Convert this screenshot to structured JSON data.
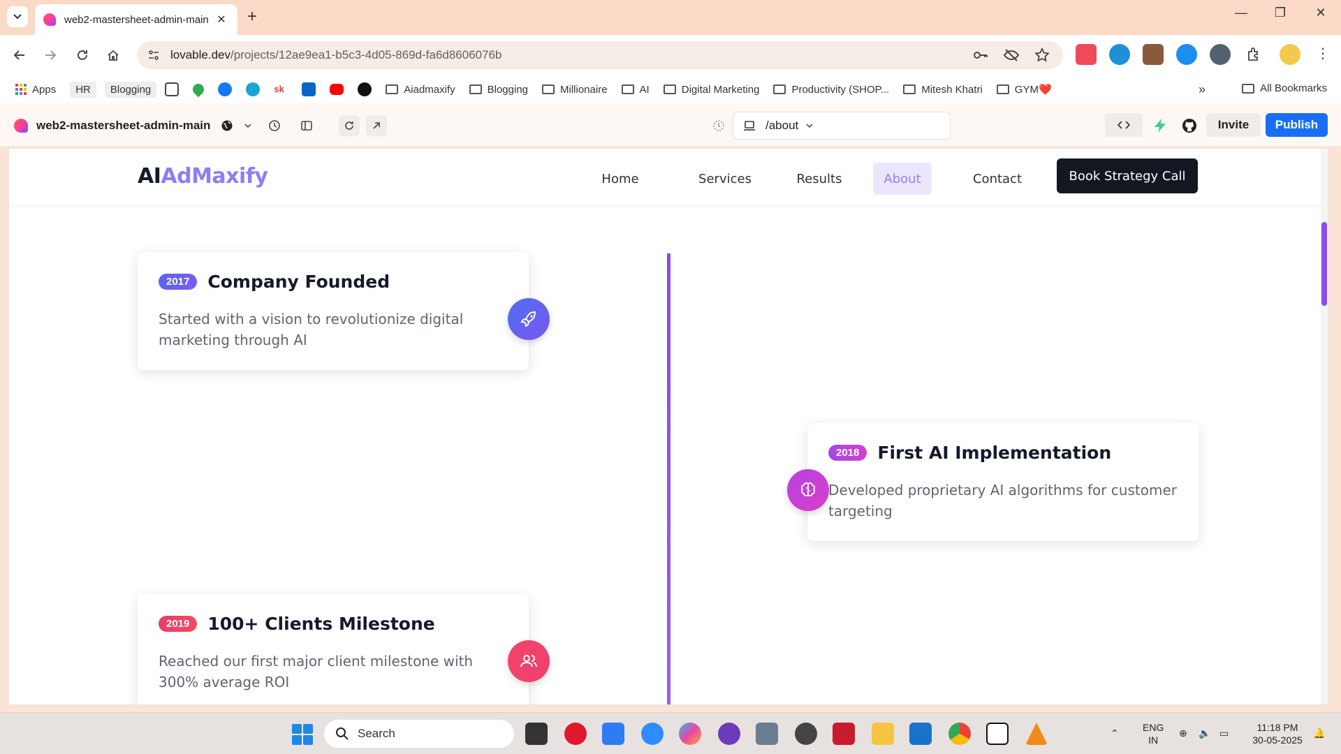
{
  "browser": {
    "tab_title": "web2-mastersheet-admin-main",
    "url_domain": "lovable.dev",
    "url_path": "/projects/12ae9ea1-b5c3-4d05-869d-fa6d8606076b"
  },
  "bookmarks": {
    "apps": "Apps",
    "chips": [
      "HR",
      "Blogging"
    ],
    "folders": [
      "Aiadmaxify",
      "Blogging",
      "Millionaire",
      "AI",
      "Digital Marketing",
      "Productivity (SHOP...",
      "Mitesh Khatri",
      "GYM❤️"
    ],
    "all": "All Bookmarks"
  },
  "app": {
    "project_name": "web2-mastersheet-admin-main",
    "route": "/about",
    "invite": "Invite",
    "publish": "Publish"
  },
  "site": {
    "brand_a": "AI",
    "brand_b": "AdMaxify",
    "nav": [
      "Home",
      "Services",
      "Results",
      "About",
      "Contact"
    ],
    "active_nav": "About",
    "cta": "Book Strategy Call"
  },
  "timeline": [
    {
      "year": "2017",
      "title": "Company Founded",
      "desc": "Started with a vision to revolutionize digital marketing through AI",
      "icon": "rocket-icon",
      "color": "#5b6cf0"
    },
    {
      "year": "2018",
      "title": "First AI Implementation",
      "desc": "Developed proprietary AI algorithms for customer targeting",
      "icon": "brain-icon",
      "color": "#c63fd8"
    },
    {
      "year": "2019",
      "title": "100+ Clients Milestone",
      "desc": "Reached our first major client milestone with 300% average ROI",
      "icon": "users-icon",
      "color": "#f0406a"
    }
  ],
  "taskbar": {
    "search": "Search",
    "lang": "ENG",
    "region": "IN",
    "time": "11:18 PM",
    "date": "30-05-2025"
  }
}
